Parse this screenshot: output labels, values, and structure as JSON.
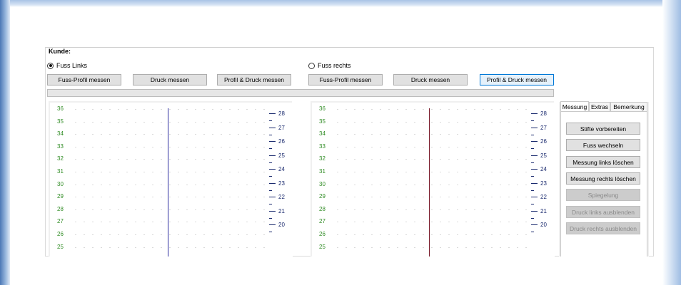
{
  "customer": {
    "label": "Kunde:"
  },
  "left": {
    "radio_label": "Fuss Links",
    "selected": true,
    "buttons": {
      "profile": "Fuss-Profil messen",
      "pressure": "Druck messen",
      "both": "Profil & Druck messen"
    }
  },
  "right": {
    "radio_label": "Fuss rechts",
    "selected": false,
    "buttons": {
      "profile": "Fuss-Profil messen",
      "pressure": "Druck messen",
      "both": "Profil & Druck messen"
    }
  },
  "tabs": [
    "Messung",
    "Extras",
    "Bemerkung"
  ],
  "active_tab": "Messung",
  "actions": {
    "prepare_pins": "Stifte vorbereiten",
    "switch_foot": "Fuss wechseln",
    "clear_left": "Messung links löschen",
    "clear_right": "Messung rechts löschen",
    "mirror": "Spiegelung",
    "hide_pressure_left": "Druck links ausblenden",
    "hide_pressure_right": "Druck rechts ausblenden"
  },
  "chart_data": [
    {
      "type": "scatter",
      "name": "left-foot-grid",
      "y_left_ticks": [
        "36",
        "35",
        "34",
        "33",
        "32",
        "31",
        "30",
        "29",
        "28",
        "27",
        "26",
        "25"
      ],
      "y_right_ticks": [
        "28",
        "27",
        "26",
        "25",
        "24",
        "23",
        "22",
        "21",
        "20"
      ],
      "marker_line_color": "#2b2b9e",
      "grid": "dotted"
    },
    {
      "type": "scatter",
      "name": "right-foot-grid",
      "y_left_ticks": [
        "36",
        "35",
        "34",
        "33",
        "32",
        "31",
        "30",
        "29",
        "28",
        "27",
        "26",
        "25"
      ],
      "y_right_ticks": [
        "28",
        "27",
        "26",
        "25",
        "24",
        "23",
        "22",
        "21",
        "20"
      ],
      "marker_line_color": "#7a1a2a",
      "grid": "dotted"
    }
  ],
  "colors": {
    "left_tick": "#2e8b22",
    "right_tick": "#1a2a6e",
    "focus": "#0078d7"
  }
}
